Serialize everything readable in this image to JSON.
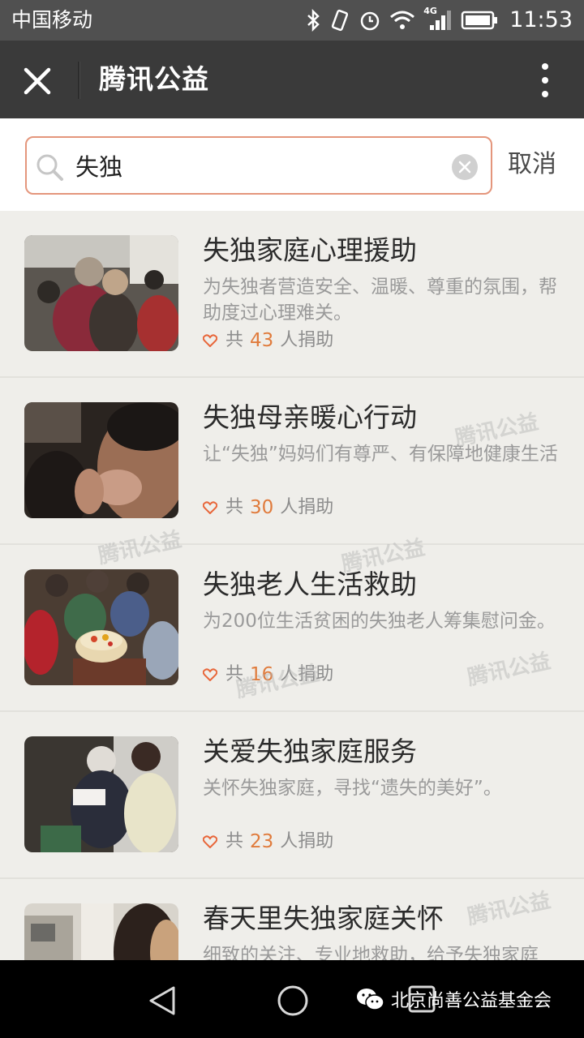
{
  "status_bar": {
    "carrier": "中国移动",
    "network": "4G",
    "time": "11:53"
  },
  "app_bar": {
    "title": "腾讯公益"
  },
  "search": {
    "value": "失独",
    "cancel_label": "取消"
  },
  "results": [
    {
      "title": "失独家庭心理援助",
      "description": "为失独者营造安全、温暖、尊重的氛围，帮助度过心理难关。",
      "donate_prefix": "共",
      "count": "43",
      "donate_suffix": "人捐助"
    },
    {
      "title": "失独母亲暖心行动",
      "description": "让“失独”妈妈们有尊严、有保障地健康生活",
      "donate_prefix": "共",
      "count": "30",
      "donate_suffix": "人捐助"
    },
    {
      "title": "失独老人生活救助",
      "description": "为200位生活贫困的失独老人筹集慰问金。",
      "donate_prefix": "共",
      "count": "16",
      "donate_suffix": "人捐助"
    },
    {
      "title": "关爱失独家庭服务",
      "description": "关怀失独家庭，寻找“遗失的美好”。",
      "donate_prefix": "共",
      "count": "23",
      "donate_suffix": "人捐助"
    },
    {
      "title": "春天里失独家庭关怀",
      "description": "细致的关注、专业地救助，给予失独家庭",
      "donate_prefix": "",
      "count": "",
      "donate_suffix": ""
    }
  ],
  "watermark_text": "腾讯公益",
  "nav_bar": {
    "brand": "北京尚善公益基金会"
  },
  "colors": {
    "accent": "#e07b3c",
    "search_border": "#e4967c",
    "heart": "#e8663a"
  }
}
